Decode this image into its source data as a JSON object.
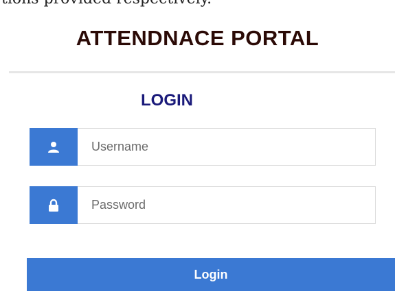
{
  "document_fragment": "tions provided respectively.",
  "portal": {
    "title": "ATTENDNACE PORTAL"
  },
  "form": {
    "heading": "LOGIN",
    "username": {
      "placeholder": "Username",
      "icon": "user-icon"
    },
    "password": {
      "placeholder": "Password",
      "icon": "lock-icon"
    },
    "submit_label": "Login"
  },
  "colors": {
    "accent": "#3b79d3",
    "title": "#2b0a06",
    "heading": "#1a1a7a",
    "placeholder": "#6b6b6b",
    "divider": "#e6e6e6"
  }
}
